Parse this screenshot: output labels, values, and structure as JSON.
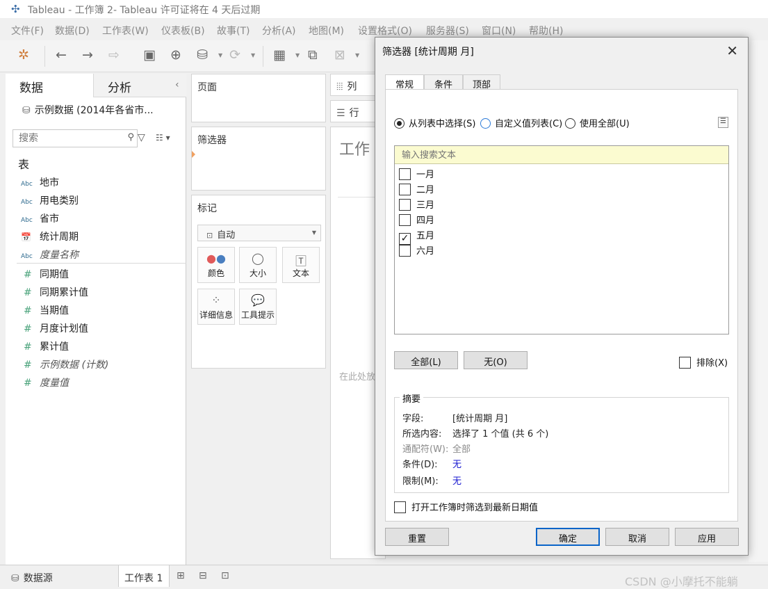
{
  "window": {
    "title": "Tableau - 工作簿 2- Tableau 许可证将在 4 天后过期",
    "app_icon": "tableau-logo-icon"
  },
  "menu": [
    "文件(F)",
    "数据(D)",
    "工作表(W)",
    "仪表板(B)",
    "故事(T)",
    "分析(A)",
    "地图(M)",
    "设置格式(O)",
    "服务器(S)",
    "窗口(N)",
    "帮助(H)"
  ],
  "data_pane": {
    "tabs": {
      "data": "数据",
      "analysis": "分析"
    },
    "datasource": "示例数据 (2014年各省市...",
    "search_placeholder": "搜索",
    "tables_heading": "表",
    "dimensions": [
      {
        "type": "Abc",
        "name": "地市"
      },
      {
        "type": "Abc",
        "name": "用电类别"
      },
      {
        "type": "Abc",
        "name": "省市"
      },
      {
        "type": "date",
        "name": "统计周期"
      },
      {
        "type": "Abc",
        "name": "度量名称"
      }
    ],
    "measures": [
      {
        "type": "#",
        "name": "同期值"
      },
      {
        "type": "#",
        "name": "同期累计值"
      },
      {
        "type": "#",
        "name": "当期值"
      },
      {
        "type": "#",
        "name": "月度计划值"
      },
      {
        "type": "#",
        "name": "累计值"
      },
      {
        "type": "#",
        "name": "示例数据 (计数)"
      },
      {
        "type": "#",
        "name": "度量值"
      }
    ]
  },
  "shelves": {
    "pages": "页面",
    "filters": "筛选器",
    "marks": "标记",
    "mark_type": "自动",
    "mark_buttons": {
      "color": "颜色",
      "size": "大小",
      "text": "文本",
      "detail": "详细信息",
      "tooltip": "工具提示"
    },
    "columns": "列",
    "rows": "行"
  },
  "canvas": {
    "title": "工作",
    "hint": "在此处放"
  },
  "bottom": {
    "datasource_tab": "数据源",
    "sheet_tab": "工作表 1",
    "watermark": "CSDN @小摩托不能躺"
  },
  "dialog": {
    "title": "筛选器 [统计周期 月]",
    "tabs": [
      "常规",
      "条件",
      "顶部"
    ],
    "radio": {
      "from_list": "从列表中选择(S)",
      "custom": "自定义值列表(C)",
      "use_all": "使用全部(U)"
    },
    "search_placeholder": "输入搜索文本",
    "values": [
      {
        "label": "一月",
        "checked": false
      },
      {
        "label": "二月",
        "checked": false
      },
      {
        "label": "三月",
        "checked": false
      },
      {
        "label": "四月",
        "checked": false
      },
      {
        "label": "五月",
        "checked": true
      },
      {
        "label": "六月",
        "checked": false
      }
    ],
    "all_button": "全部(L)",
    "none_button": "无(O)",
    "exclude": "排除(X)",
    "summary": {
      "title": "摘要",
      "field_label": "字段:",
      "field_value": "[统计周期 月]",
      "selected_label": "所选内容:",
      "selected_value": "选择了 1 个值 (共 6 个)",
      "wildcard_label": "通配符(W):",
      "wildcard_value": "全部",
      "condition_label": "条件(D):",
      "condition_value": "无",
      "limit_label": "限制(M):",
      "limit_value": "无"
    },
    "latest_date": "打开工作簿时筛选到最新日期值",
    "buttons": {
      "reset": "重置",
      "ok": "确定",
      "cancel": "取消",
      "apply": "应用"
    }
  }
}
